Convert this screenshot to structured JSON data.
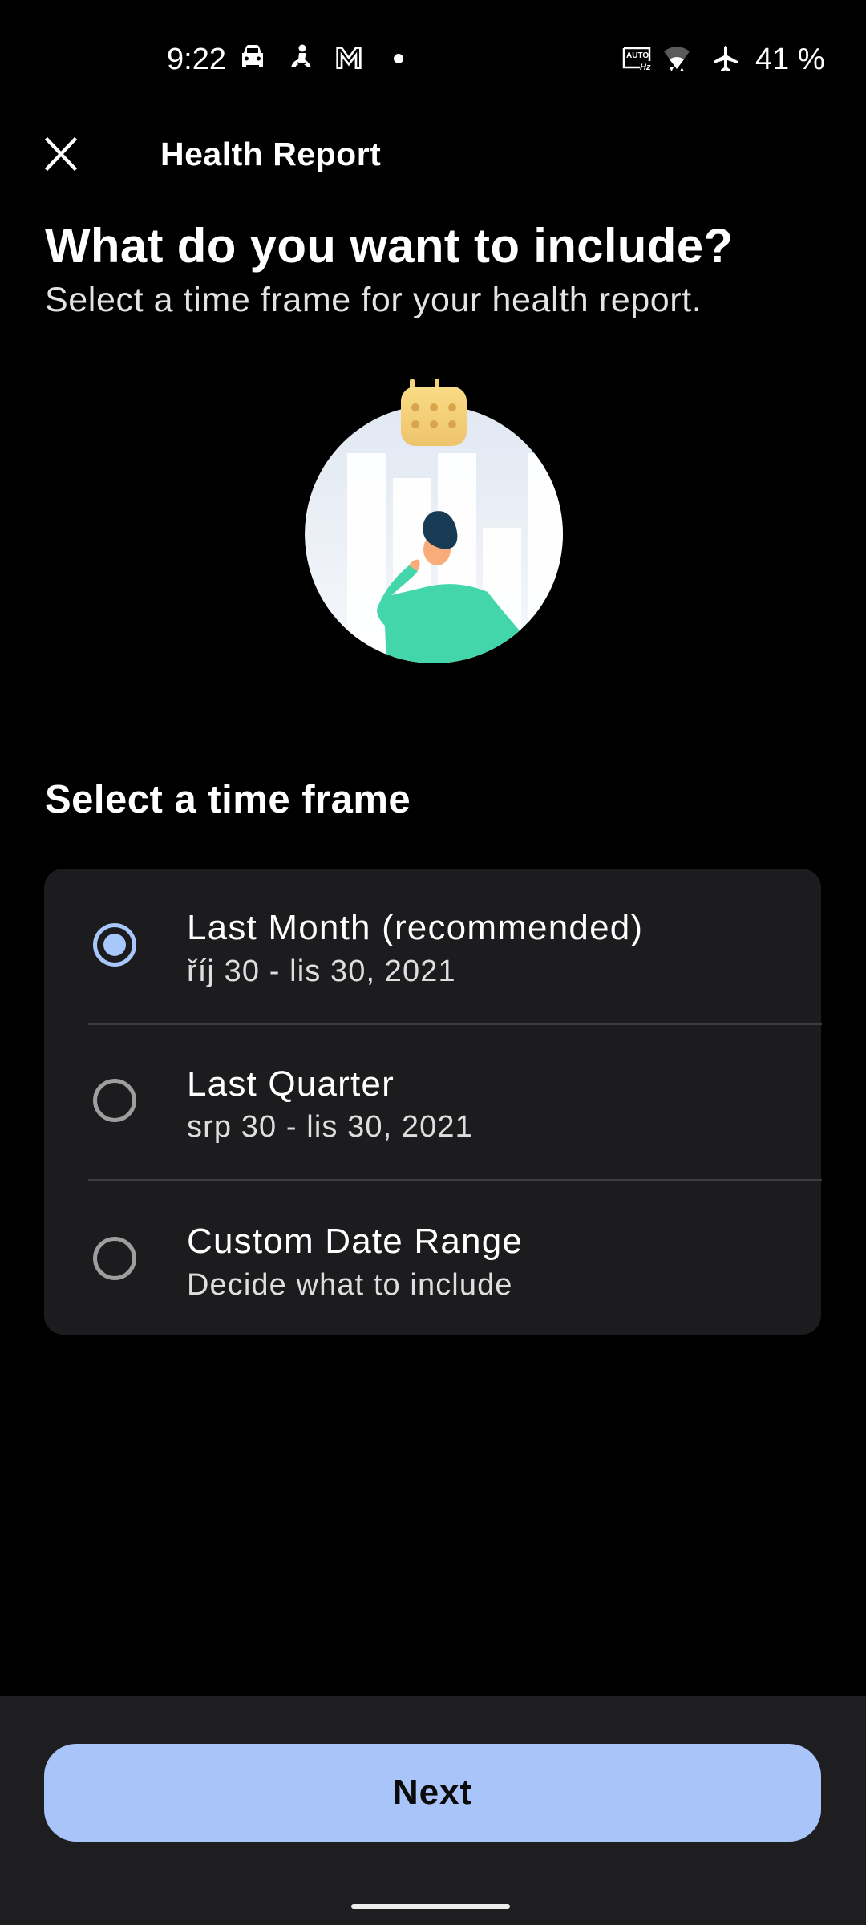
{
  "status_bar": {
    "time": "9:22",
    "left_icons": [
      "car-icon",
      "meditation-icon",
      "gmail-icon",
      "notification-dot-icon"
    ],
    "right_icons": [
      "auto-hz-icon",
      "wifi-icon",
      "airplane-mode-icon"
    ],
    "auto_hz_top": "AUTO",
    "auto_hz_bottom": "Hz",
    "battery": "41 %"
  },
  "app_bar": {
    "close_icon": "close-icon",
    "title": "Health Report"
  },
  "intro": {
    "heading": "What do you want to include?",
    "subheading": "Select a time frame for your health report."
  },
  "illustration": {
    "icon": "calendar-icon",
    "description": "person-looking-at-bar-chart"
  },
  "time_frame": {
    "section_title": "Select a time frame",
    "selected_index": 0,
    "options": [
      {
        "title": "Last Month (recommended)",
        "subtitle": "říj 30 - lis 30, 2021",
        "selected": true
      },
      {
        "title": "Last Quarter",
        "subtitle": "srp 30 - lis 30, 2021",
        "selected": false
      },
      {
        "title": "Custom Date Range",
        "subtitle": "Decide what to include",
        "selected": false
      }
    ]
  },
  "footer": {
    "next_label": "Next"
  },
  "colors": {
    "accent": "#a8c7fa",
    "button": "#a8c4f8",
    "card": "#1c1c1e",
    "background": "#000000"
  }
}
